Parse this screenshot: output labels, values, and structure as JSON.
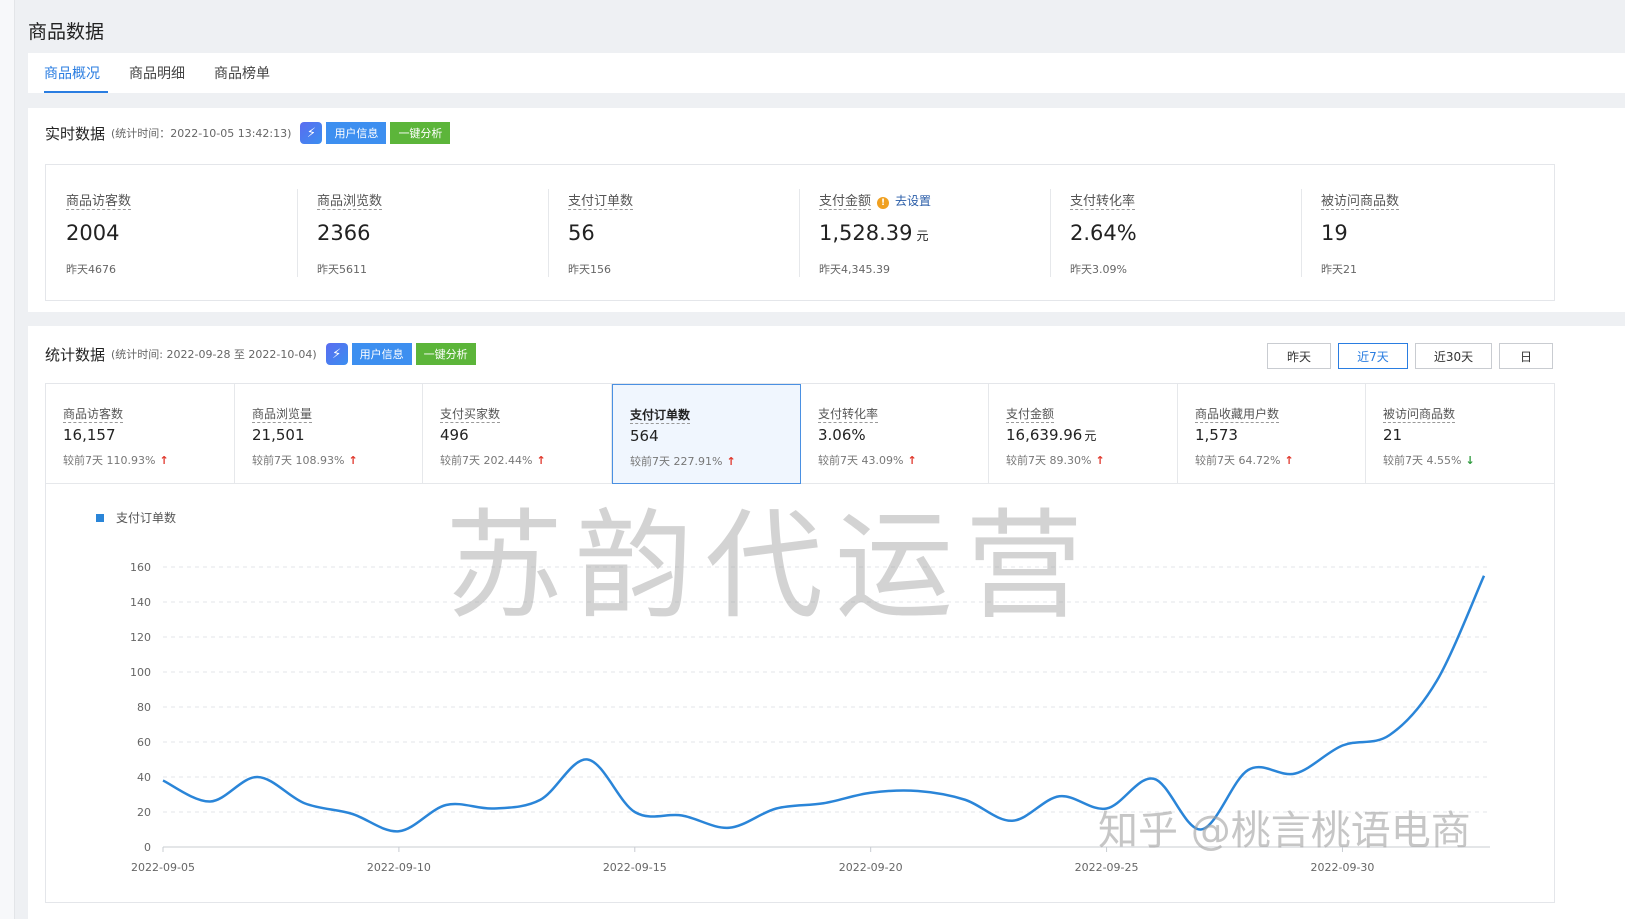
{
  "page": {
    "title": "商品数据"
  },
  "tabs": [
    {
      "label": "商品概况",
      "active": true
    },
    {
      "label": "商品明细",
      "active": false
    },
    {
      "label": "商品榜单",
      "active": false
    }
  ],
  "realtime": {
    "title": "实时数据",
    "time_text": "(统计时间：2022-10-05 13:42:13)",
    "user_info_btn": "用户信息",
    "analyze_btn": "一键分析",
    "metrics": [
      {
        "label": "商品访客数",
        "value": "2004",
        "unit": "",
        "prev": "昨天4676"
      },
      {
        "label": "商品浏览数",
        "value": "2366",
        "unit": "",
        "prev": "昨天5611"
      },
      {
        "label": "支付订单数",
        "value": "56",
        "unit": "",
        "prev": "昨天156"
      },
      {
        "label": "支付金额",
        "value": "1,528.39",
        "unit": "元",
        "prev": "昨天4,345.39",
        "link": "去设置",
        "warn": "!"
      },
      {
        "label": "支付转化率",
        "value": "2.64%",
        "unit": "",
        "prev": "昨天3.09%"
      },
      {
        "label": "被访问商品数",
        "value": "19",
        "unit": "",
        "prev": "昨天21"
      }
    ]
  },
  "stats": {
    "title": "统计数据",
    "time_text": "(统计时间: 2022-09-28 至 2022-10-04)",
    "user_info_btn": "用户信息",
    "analyze_btn": "一键分析",
    "ranges": [
      {
        "label": "昨天",
        "active": false
      },
      {
        "label": "近7天",
        "active": true
      },
      {
        "label": "近30天",
        "active": false
      },
      {
        "label": "日",
        "active": false
      }
    ],
    "metrics": [
      {
        "label": "商品访客数",
        "value": "16,157",
        "unit": "",
        "cmp": "较前7天 110.93%",
        "dir": "up"
      },
      {
        "label": "商品浏览量",
        "value": "21,501",
        "unit": "",
        "cmp": "较前7天 108.93%",
        "dir": "up"
      },
      {
        "label": "支付买家数",
        "value": "496",
        "unit": "",
        "cmp": "较前7天 202.44%",
        "dir": "up"
      },
      {
        "label": "支付订单数",
        "value": "564",
        "unit": "",
        "cmp": "较前7天 227.91%",
        "dir": "up",
        "active": true
      },
      {
        "label": "支付转化率",
        "value": "3.06%",
        "unit": "",
        "cmp": "较前7天 43.09%",
        "dir": "up"
      },
      {
        "label": "支付金额",
        "value": "16,639.96",
        "unit": "元",
        "cmp": "较前7天 89.30%",
        "dir": "up"
      },
      {
        "label": "商品收藏用户数",
        "value": "1,573",
        "unit": "",
        "cmp": "较前7天 64.72%",
        "dir": "up"
      },
      {
        "label": "被访问商品数",
        "value": "21",
        "unit": "",
        "cmp": "较前7天 4.55%",
        "dir": "down"
      }
    ],
    "arrow_up": "↑",
    "arrow_down": "↓"
  },
  "chart_data": {
    "type": "line",
    "series": [
      {
        "name": "支付订单数",
        "color": "#2a85d8",
        "values": [
          38,
          26,
          40,
          25,
          19,
          9,
          24,
          22,
          27,
          50,
          20,
          18,
          11,
          22,
          25,
          31,
          32,
          27,
          15,
          29,
          22,
          39,
          10,
          44,
          42,
          58,
          64,
          95,
          155
        ]
      }
    ],
    "x": [
      "2022-09-05",
      "2022-09-06",
      "2022-09-07",
      "2022-09-08",
      "2022-09-09",
      "2022-09-10",
      "2022-09-11",
      "2022-09-12",
      "2022-09-13",
      "2022-09-14",
      "2022-09-15",
      "2022-09-16",
      "2022-09-17",
      "2022-09-18",
      "2022-09-19",
      "2022-09-20",
      "2022-09-21",
      "2022-09-22",
      "2022-09-23",
      "2022-09-24",
      "2022-09-25",
      "2022-09-26",
      "2022-09-27",
      "2022-09-28",
      "2022-09-29",
      "2022-09-30",
      "2022-10-01",
      "2022-10-02",
      "2022-10-03"
    ],
    "x_tick_labels": [
      "2022-09-05",
      "2022-09-10",
      "2022-09-15",
      "2022-09-20",
      "2022-09-25",
      "2022-09-30"
    ],
    "y_ticks": [
      0,
      20,
      40,
      60,
      80,
      100,
      120,
      140,
      160
    ],
    "ylim": [
      0,
      160
    ],
    "grid": true,
    "legend": "top-left"
  },
  "watermarks": {
    "main": "苏韵代运营",
    "corner": "知乎 @桃言桃语电商"
  }
}
